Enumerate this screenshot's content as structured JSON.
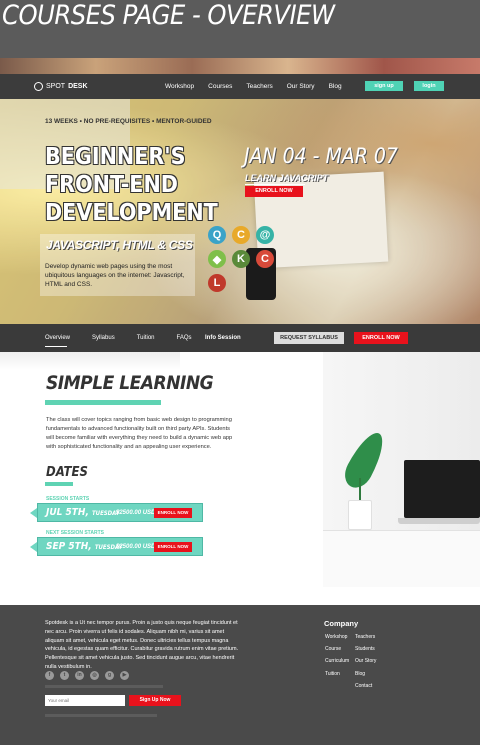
{
  "page_title": "COURSES PAGE - OVERVIEW",
  "navbar": {
    "logo_light": "SPOT",
    "logo_bold": "DESK",
    "links": [
      "Workshop",
      "Courses",
      "Teachers",
      "Our Story",
      "Blog"
    ],
    "signup": "sign up",
    "login": "login"
  },
  "hero": {
    "tagline": "13 WEEKS • NO PRE-REQUISITES • MENTOR-GUIDED",
    "title_lines": [
      "BEGINNER'S",
      "FRONT-END",
      "DEVELOPMENT"
    ],
    "subtitle": "JAVASCRIPT, HTML & CSS",
    "description": "Develop dynamic web pages using the most ubiquitous languages on the internet: Javascript, HTML and CSS.",
    "date_range": "JAN 04 - MAR 07",
    "learn": "LEARN JAVACRIPT",
    "enroll": "ENROLL NOW"
  },
  "subnav": {
    "tabs": [
      "Overview",
      "Syllabus",
      "Tuition",
      "FAQs"
    ],
    "info": "Info Session",
    "request": "REQUEST SYLLABUS",
    "enroll": "ENROLL NOW"
  },
  "content": {
    "simple_title": "SIMPLE LEARNING",
    "simple_text": "The class will cover topics ranging from basic web design to programming fundamentals to advanced functionality built on third party APIs. Students will become familiar with everything they need to build a dynamic web app with sophisticated functionality and an appealing user experience.",
    "dates_title": "DATES",
    "sessions": [
      {
        "label": "SESSION STARTS",
        "date": "JUL 5TH,",
        "day": "TUESDAY",
        "price": "$2500.00 USD",
        "button": "ENROLL NOW"
      },
      {
        "label": "NEXT SESSION STARTS",
        "date": "SEP 5TH,",
        "day": "TUESDAY",
        "price": "$2500.00 USD",
        "button": "ENROLL NOW"
      }
    ]
  },
  "footer": {
    "about": "Spotdesk is a Ut nec tempor purus. Proin a justo quis neque feugiat tincidunt et nec arcu. Proin viverra ut felis id sodales. Aliquam nibh mi, varius sit amet aliquam sit amet, vehicula eget metus. Donec ultricies tellus tempus magna vehicula, id egestas quam efficitur. Curabitur gravida rutrum enim vitae pretium. Pellentesque sit amet vehicula justo. Sed tincidunt augue arcu, vitae hendrerit nulla vestibulum in.",
    "social_icons": [
      "facebook-icon",
      "twitter-icon",
      "linkedin-icon",
      "instagram-icon",
      "google-plus-icon",
      "youtube-icon"
    ],
    "email_placeholder": "Your email",
    "signup": "Sign Up Now",
    "company_title": "Company",
    "col1": [
      "Workshop",
      "Course",
      "Curriculum",
      "Tuition"
    ],
    "col2": [
      "Teachers",
      "Students",
      "Our Story",
      "Blog",
      "Contact"
    ]
  },
  "colors": {
    "accent_teal": "#5fd3b3",
    "accent_red": "#e8121c",
    "dark": "#3a3a3a"
  }
}
